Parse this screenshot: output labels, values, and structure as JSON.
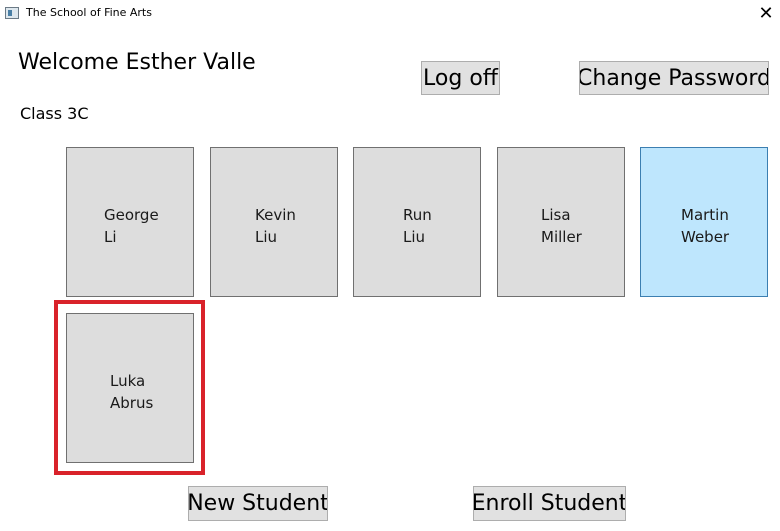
{
  "window": {
    "title": "The School of Fine Arts",
    "close_glyph": "✕"
  },
  "header": {
    "welcome": "Welcome Esther Valle",
    "class_label": "Class 3C",
    "logoff_label": "Log off",
    "change_password_label": "Change Password"
  },
  "students": [
    {
      "first": "George",
      "last": "Li",
      "selected": false
    },
    {
      "first": "Kevin",
      "last": "Liu",
      "selected": false
    },
    {
      "first": "Run",
      "last": "Liu",
      "selected": false
    },
    {
      "first": "Lisa",
      "last": "Miller",
      "selected": false
    },
    {
      "first": "Martin",
      "last": "Weber",
      "selected": true
    },
    {
      "first": "Luka",
      "last": "Abrus",
      "selected": false
    }
  ],
  "footer": {
    "new_student_label": "New Student",
    "enroll_student_label": "Enroll Student"
  },
  "colors": {
    "tile_bg": "#dddddd",
    "tile_selected_bg": "#bee6fd",
    "highlight": "#d9222a",
    "button_bg": "#e1e1e1"
  }
}
